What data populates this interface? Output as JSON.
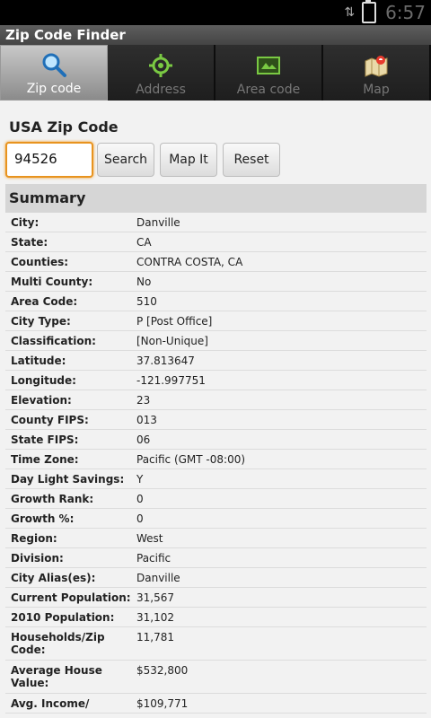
{
  "status": {
    "time": "6:57"
  },
  "app": {
    "title": "Zip Code Finder"
  },
  "tabs": [
    {
      "label": "Zip code",
      "icon": "magnifier-icon",
      "active": true
    },
    {
      "label": "Address",
      "icon": "target-icon",
      "active": false
    },
    {
      "label": "Area code",
      "icon": "map-frame-icon",
      "active": false
    },
    {
      "label": "Map",
      "icon": "map-pin-icon",
      "active": false
    }
  ],
  "form": {
    "heading": "USA Zip Code",
    "zip_value": "94526",
    "search_label": "Search",
    "mapit_label": "Map It",
    "reset_label": "Reset"
  },
  "summary": {
    "heading": "Summary",
    "rows": [
      {
        "k": "City:",
        "v": "Danville"
      },
      {
        "k": "State:",
        "v": "CA"
      },
      {
        "k": "Counties:",
        "v": "CONTRA COSTA, CA"
      },
      {
        "k": "Multi County:",
        "v": "No"
      },
      {
        "k": "Area Code:",
        "v": "510"
      },
      {
        "k": "City Type:",
        "v": "P [Post Office]"
      },
      {
        "k": "Classification:",
        "v": "[Non-Unique]"
      },
      {
        "k": "Latitude:",
        "v": "37.813647"
      },
      {
        "k": "Longitude:",
        "v": "-121.997751"
      },
      {
        "k": "Elevation:",
        "v": "23"
      },
      {
        "k": "County FIPS:",
        "v": "013"
      },
      {
        "k": "State FIPS:",
        "v": "06"
      },
      {
        "k": "Time Zone:",
        "v": "Pacific (GMT -08:00)"
      },
      {
        "k": "Day Light Savings:",
        "v": "Y"
      },
      {
        "k": "Growth Rank:",
        "v": "0"
      },
      {
        "k": "Growth %:",
        "v": "0"
      },
      {
        "k": "Region:",
        "v": "West"
      },
      {
        "k": "Division:",
        "v": "Pacific"
      },
      {
        "k": "City Alias(es):",
        "v": "Danville"
      },
      {
        "k": "Current Population:",
        "v": "31,567"
      },
      {
        "k": "2010 Population:",
        "v": "31,102"
      },
      {
        "k": "Households/Zip Code:",
        "v": "11,781"
      },
      {
        "k": "Average House Value:",
        "v": "$532,800"
      },
      {
        "k": "Avg. Income/",
        "v": "$109,771"
      }
    ]
  }
}
